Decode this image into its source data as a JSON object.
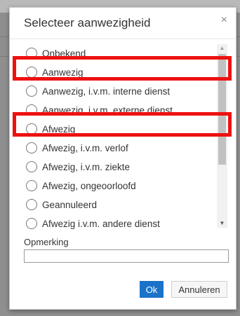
{
  "dialog": {
    "title": "Selecteer aanwezigheid",
    "close_symbol": "×",
    "options": [
      "Onbekend",
      "Aanwezig",
      "Aanwezig, i.v.m. interne dienst",
      "Aanwezig, i.v.m. externe dienst",
      "Afwezig",
      "Afwezig, i.v.m. verlof",
      "Afwezig, i.v.m. ziekte",
      "Afwezig, ongeoorloofd",
      "Geannuleerd",
      "Afwezig i.v.m. andere dienst"
    ],
    "remark_label": "Opmerking",
    "remark_value": "",
    "ok_label": "Ok",
    "cancel_label": "Annuleren"
  },
  "colors": {
    "highlight": "#ee1111",
    "primary_button": "#1a73c8"
  },
  "icons": {
    "scroll_up": "triangle-up-icon",
    "scroll_down": "triangle-down-icon"
  }
}
